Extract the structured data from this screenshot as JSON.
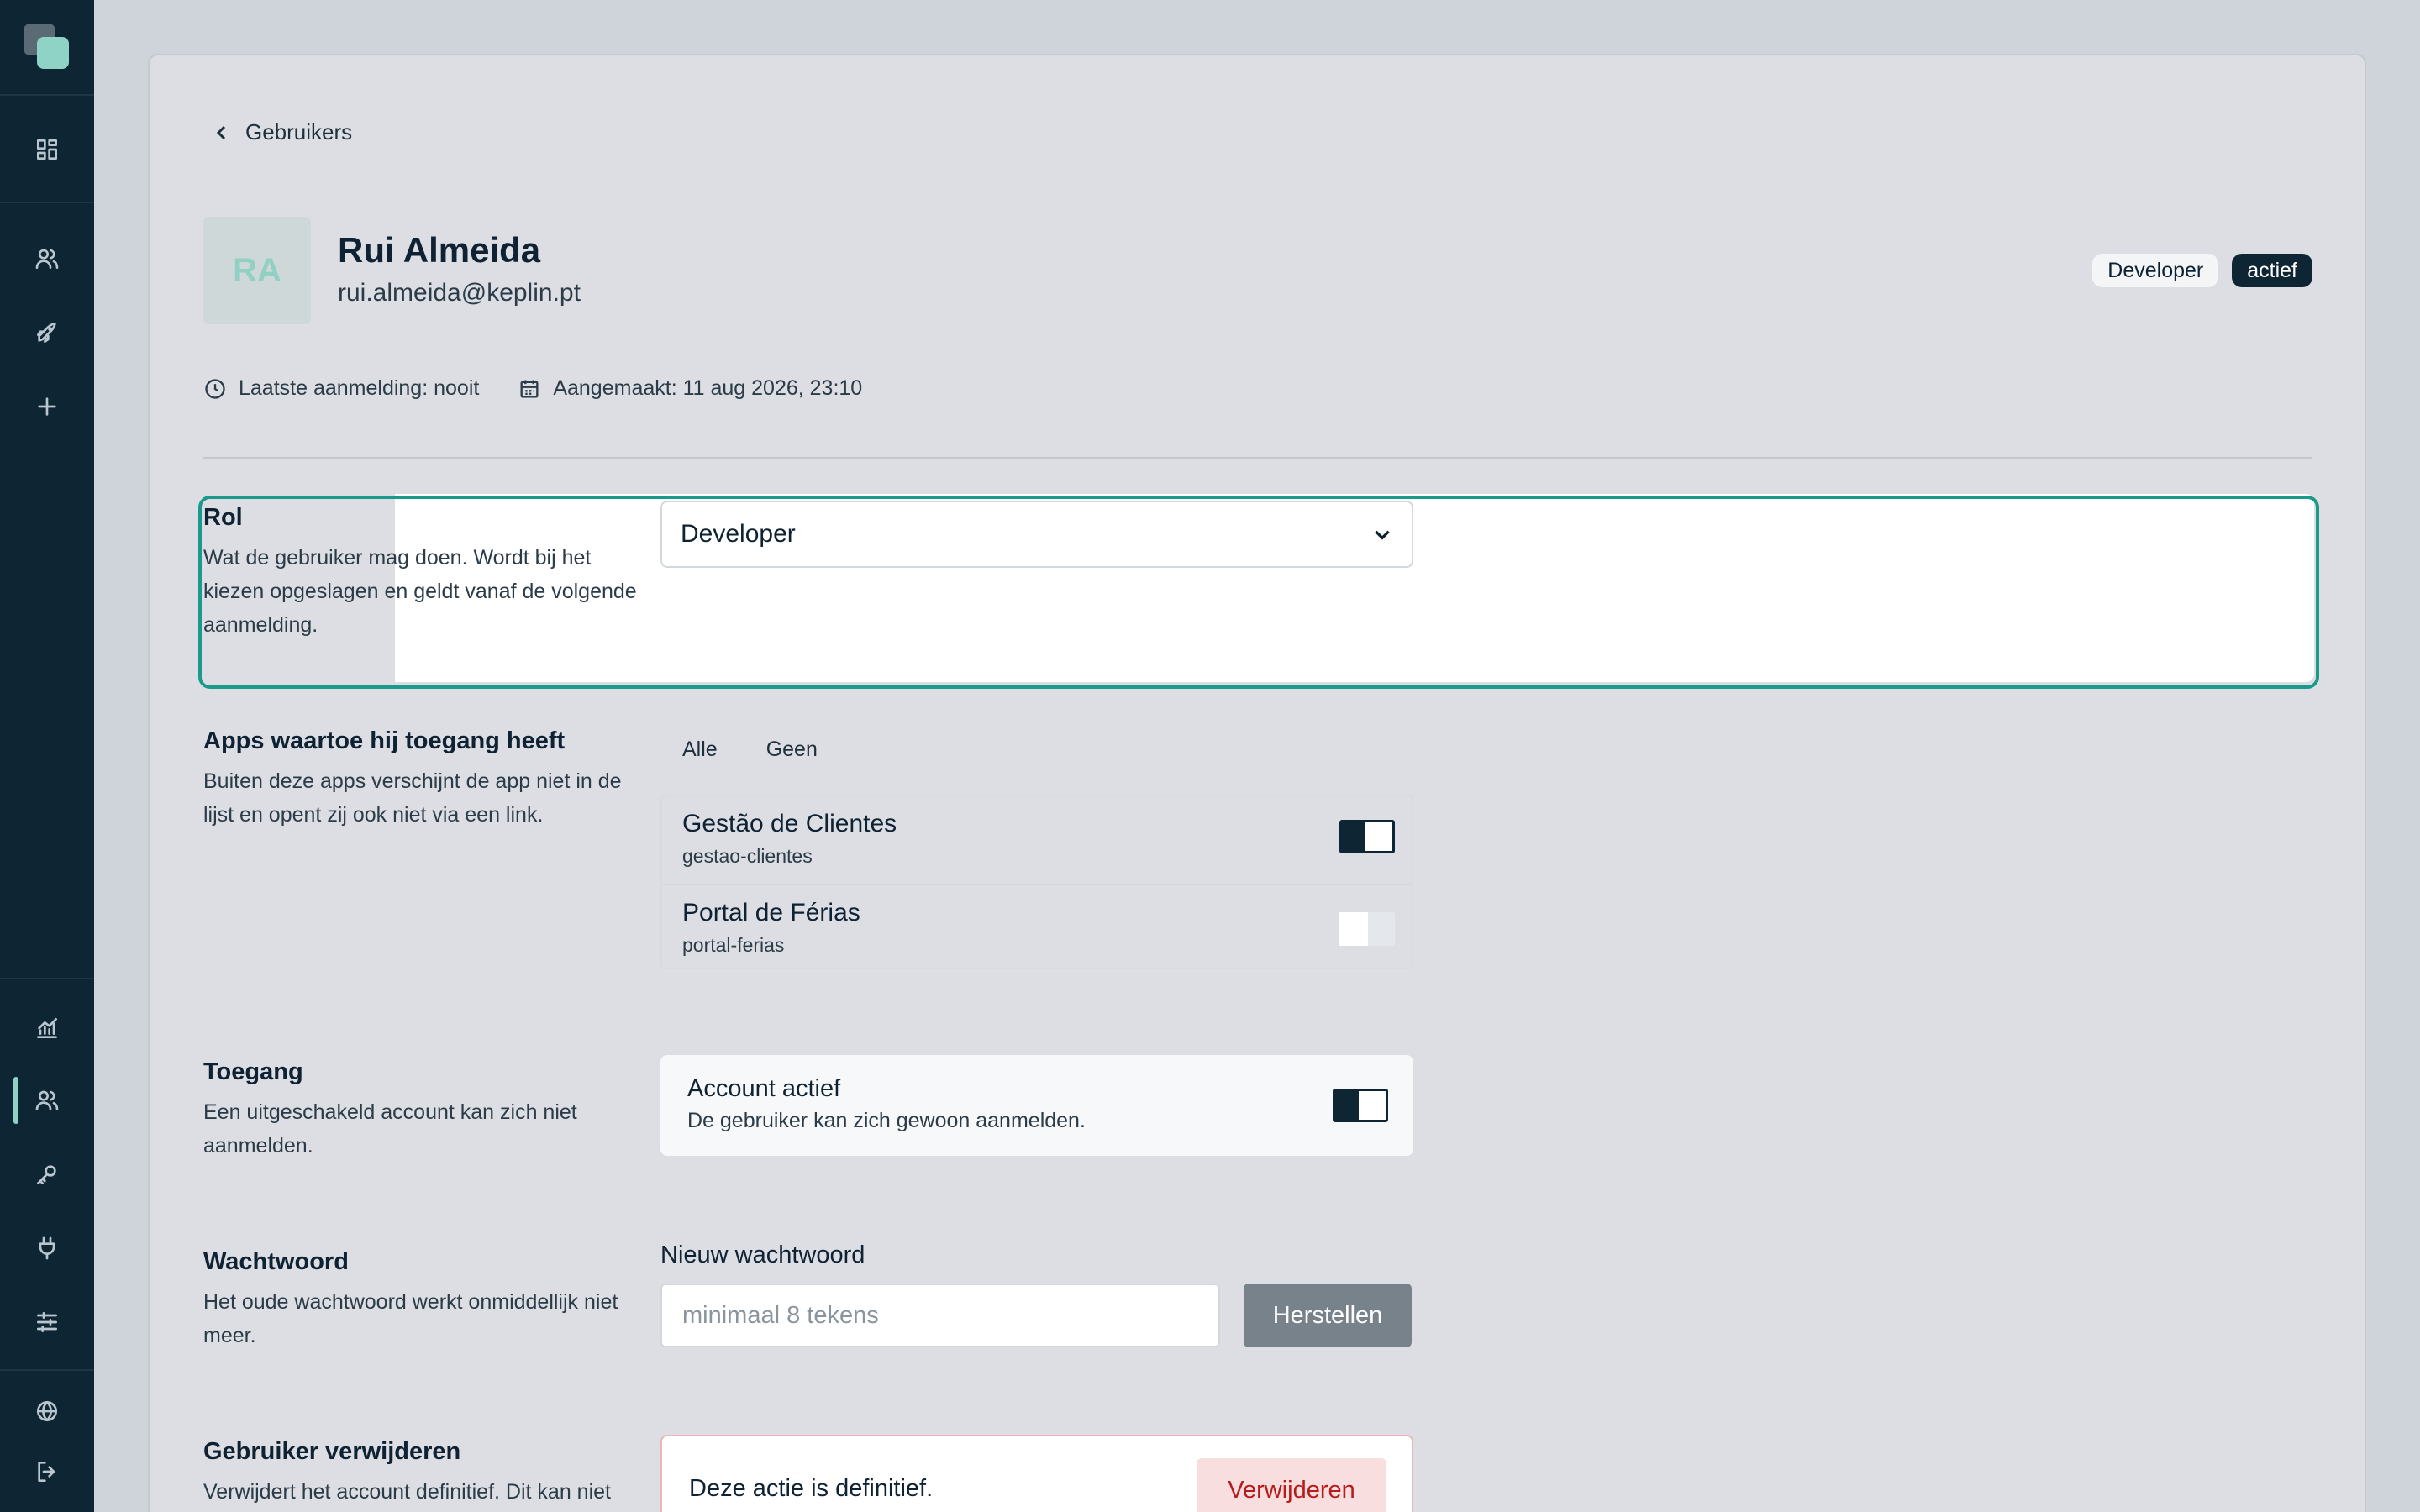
{
  "sidebar": {
    "logo": "app-logo",
    "top_icons": [
      "dashboard-icon",
      "users-icon",
      "rocket-icon",
      "plus-icon"
    ],
    "bottom_icons": [
      "chart-icon",
      "users-icon",
      "key-icon",
      "plug-icon",
      "sliders-icon",
      "globe-icon",
      "logout-icon"
    ],
    "active_item": "users",
    "accent_color": "#8fd3c6"
  },
  "breadcrumb": {
    "back_label": "Gebruikers"
  },
  "user": {
    "initials": "RA",
    "name": "Rui Almeida",
    "email": "rui.almeida@keplin.pt",
    "role_badge": "Developer",
    "status_badge": "actief",
    "last_login": "Laatste aanmelding: nooit",
    "created": "Aangemaakt: 11 aug 2026, 23:10"
  },
  "role_section": {
    "title": "Rol",
    "description": "Wat de gebruiker mag doen. Wordt bij het kiezen opgeslagen en geldt vanaf de volgende aanmelding.",
    "selected": "Developer",
    "focus_color": "#1a9a8a"
  },
  "apps_section": {
    "title": "Apps waartoe hij toegang heeft",
    "description": "Buiten deze apps verschijnt de app niet in de lijst en opent zij ook niet via een link.",
    "filter_all": "Alle",
    "filter_none": "Geen",
    "apps": [
      {
        "name": "Gestão de Clientes",
        "slug": "gestao-clientes",
        "enabled": true
      },
      {
        "name": "Portal de Férias",
        "slug": "portal-ferias",
        "enabled": false
      }
    ]
  },
  "access_section": {
    "title": "Toegang",
    "description": "Een uitgeschakeld account kan zich niet aanmelden.",
    "toggle_title": "Account actief",
    "toggle_desc": "De gebruiker kan zich gewoon aanmelden.",
    "enabled": true
  },
  "password_section": {
    "title": "Wachtwoord",
    "description": "Het oude wachtwoord werkt onmiddellijk niet meer.",
    "field_label": "Nieuw wachtwoord",
    "placeholder": "minimaal 8 tekens",
    "value": "",
    "button_label": "Herstellen"
  },
  "delete_section": {
    "title": "Gebruiker verwijderen",
    "description": "Verwijdert het account definitief. Dit kan niet",
    "warning": "Deze actie is definitief.",
    "button_label": "Verwijderen",
    "danger_color": "#b71c1c"
  }
}
